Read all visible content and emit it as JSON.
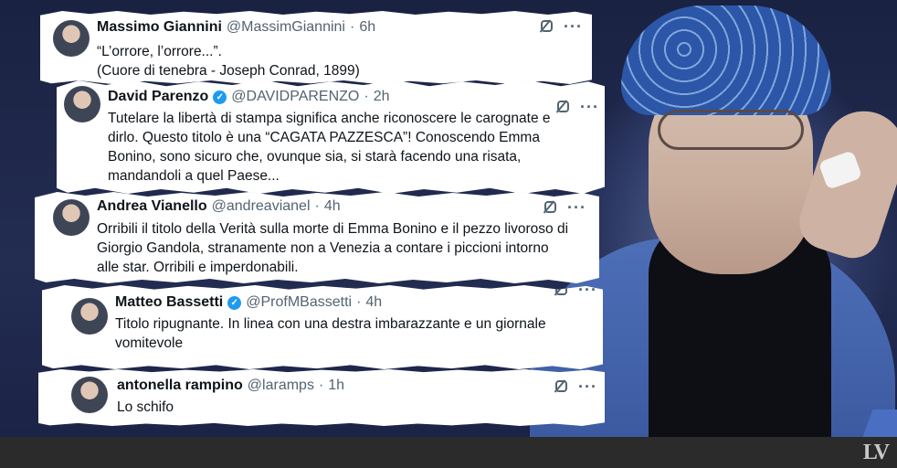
{
  "tweets": [
    {
      "name": "Massimo Giannini",
      "handle": "@MassimGiannini",
      "time": "6h",
      "verified": false,
      "lines": [
        "“L’orrore, l’orrore...”.",
        "(Cuore di tenebra - Joseph Conrad, 1899)"
      ]
    },
    {
      "name": "David Parenzo",
      "handle": "@DAVIDPARENZO",
      "time": "2h",
      "verified": true,
      "lines": [
        "Tutelare la libertà di stampa significa anche riconoscere le carognate e",
        "dirlo. Questo titolo è una “CAGATA PAZZESCA”! Conoscendo Emma",
        "Bonino, sono sicuro che, ovunque sia, si starà facendo una risata,",
        "mandandoli a quel Paese..."
      ]
    },
    {
      "name": "Andrea Vianello",
      "handle": "@andreavianel",
      "time": "4h",
      "verified": false,
      "lines": [
        "Orribili il titolo della Verità sulla morte di Emma Bonino e il pezzo livoroso di",
        "Giorgio Gandola, stranamente non a Venezia a contare i piccioni intorno",
        "alle star. Orribili e  imperdonabili."
      ]
    },
    {
      "name": "Matteo Bassetti",
      "handle": "@ProfMBassetti",
      "time": "4h",
      "verified": true,
      "lines": [
        "Titolo ripugnante. In linea con una destra imbarazzante e un giornale",
        "vomitevole"
      ]
    },
    {
      "name": "antonella rampino",
      "handle": "@laramps",
      "time": "1h",
      "verified": false,
      "lines": [
        "Lo schifo"
      ]
    }
  ],
  "separator": "·",
  "verified_glyph": "✓",
  "more_glyph": "···",
  "icons": {
    "grok": "grok-icon",
    "more": "more-options-icon",
    "verified": "verified-badge-icon"
  },
  "colors": {
    "background": "#1d2540",
    "verified": "#1d9bf0",
    "muted": "#536471",
    "footer": "#2b2b2b"
  },
  "footer": {
    "logo": "LV"
  }
}
